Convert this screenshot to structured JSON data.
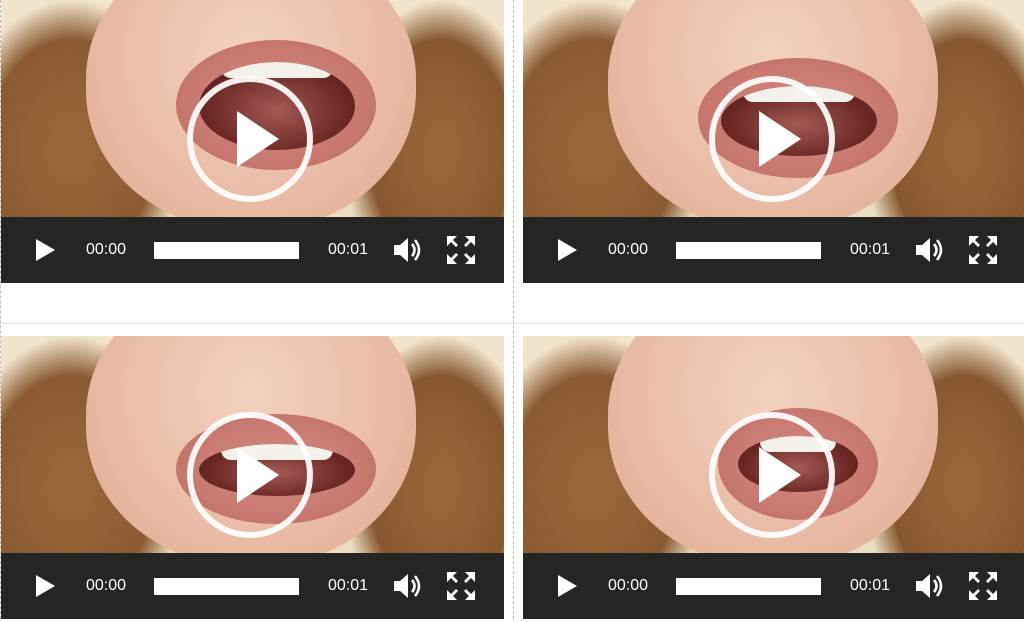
{
  "players": [
    {
      "id": "video-1",
      "current_time": "00:00",
      "duration": "00:01",
      "progress": 0.0,
      "mouth": "wide-open"
    },
    {
      "id": "video-2",
      "current_time": "00:00",
      "duration": "00:01",
      "progress": 0.0,
      "mouth": "open-smile"
    },
    {
      "id": "video-3",
      "current_time": "00:00",
      "duration": "00:01",
      "progress": 0.0,
      "mouth": "tongue-teeth"
    },
    {
      "id": "video-4",
      "current_time": "00:00",
      "duration": "00:01",
      "progress": 0.0,
      "mouth": "rounded"
    }
  ],
  "icons": {
    "big_play": "play-circle-icon",
    "play": "play-icon",
    "volume": "volume-icon",
    "fullscreen": "fullscreen-icon"
  },
  "colors": {
    "control_bar": "#252525",
    "control_text": "#ffffff",
    "progress_track": "#ffffff",
    "overlay_ring": "#ffffff"
  }
}
